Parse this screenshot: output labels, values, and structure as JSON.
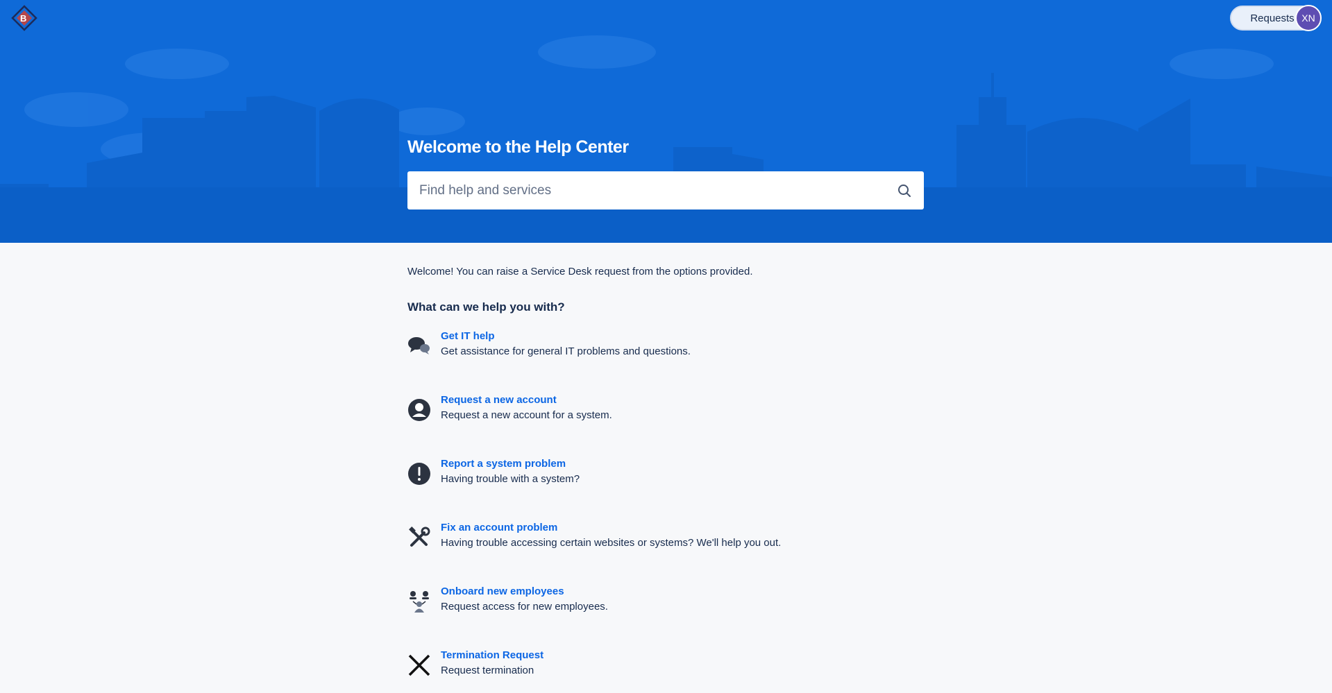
{
  "header": {
    "logo_icon": "company-logo",
    "requests_label": "Requests",
    "avatar_initials": "XN"
  },
  "hero": {
    "title": "Welcome to the Help Center",
    "search": {
      "placeholder": "Find help and services",
      "value": "",
      "icon": "search-icon"
    },
    "background_color": "#0f6ad8"
  },
  "main": {
    "intro": "Welcome! You can raise a Service Desk request from the options provided.",
    "section_title": "What can we help you with?",
    "request_types": [
      {
        "name": "Get IT help",
        "description": "Get assistance for general IT problems and questions.",
        "icon": "chat-bubbles-icon"
      },
      {
        "name": "Request a new account",
        "description": "Request a new account for a system.",
        "icon": "user-account-icon"
      },
      {
        "name": "Report a system problem",
        "description": "Having trouble with a system?",
        "icon": "exclamation-icon"
      },
      {
        "name": "Fix an account problem",
        "description": "Having trouble accessing certain websites or systems? We'll help you out.",
        "icon": "tools-icon"
      },
      {
        "name": "Onboard new employees",
        "description": "Request access for new employees.",
        "icon": "people-icon"
      },
      {
        "name": "Termination Request",
        "description": "Request termination",
        "icon": "close-x-icon"
      }
    ]
  },
  "colors": {
    "link": "#0c66e4",
    "text": "#172b4d",
    "page_background": "#f7f8fa",
    "avatar": "#5e4db2"
  }
}
